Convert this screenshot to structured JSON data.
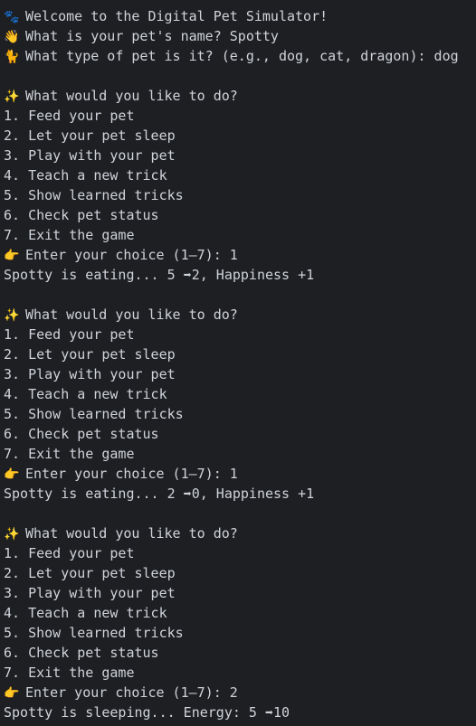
{
  "lines": [
    {
      "icon": "paw-icon",
      "glyph": "🐾",
      "text": "Welcome to the Digital Pet Simulator!"
    },
    {
      "icon": "waving-hand-icon",
      "glyph": "👋",
      "text": "What is your pet's name? Spotty"
    },
    {
      "icon": "cat-icon",
      "glyph": "🐈",
      "text": "What type of pet is it? (e.g., dog, cat, dragon): dog"
    },
    {
      "blank": true
    },
    {
      "icon": "sparkles-icon",
      "glyph": "✨",
      "text": "What would you like to do?"
    },
    {
      "text": "1. Feed your pet"
    },
    {
      "text": "2. Let your pet sleep"
    },
    {
      "text": "3. Play with your pet"
    },
    {
      "text": "4. Teach a new trick"
    },
    {
      "text": "5. Show learned tricks"
    },
    {
      "text": "6. Check pet status"
    },
    {
      "text": "7. Exit the game"
    },
    {
      "icon": "pointing-hand-icon",
      "glyph": "👉",
      "text": "Enter your choice (1–7): 1"
    },
    {
      "text": "Spotty is eating... 5 ➡2, Happiness +1"
    },
    {
      "blank": true
    },
    {
      "icon": "sparkles-icon",
      "glyph": "✨",
      "text": "What would you like to do?"
    },
    {
      "text": "1. Feed your pet"
    },
    {
      "text": "2. Let your pet sleep"
    },
    {
      "text": "3. Play with your pet"
    },
    {
      "text": "4. Teach a new trick"
    },
    {
      "text": "5. Show learned tricks"
    },
    {
      "text": "6. Check pet status"
    },
    {
      "text": "7. Exit the game"
    },
    {
      "icon": "pointing-hand-icon",
      "glyph": "👉",
      "text": "Enter your choice (1–7): 1"
    },
    {
      "text": "Spotty is eating... 2 ➡0, Happiness +1"
    },
    {
      "blank": true
    },
    {
      "icon": "sparkles-icon",
      "glyph": "✨",
      "text": "What would you like to do?"
    },
    {
      "text": "1. Feed your pet"
    },
    {
      "text": "2. Let your pet sleep"
    },
    {
      "text": "3. Play with your pet"
    },
    {
      "text": "4. Teach a new trick"
    },
    {
      "text": "5. Show learned tricks"
    },
    {
      "text": "6. Check pet status"
    },
    {
      "text": "7. Exit the game"
    },
    {
      "icon": "pointing-hand-icon",
      "glyph": "👉",
      "text": "Enter your choice (1–7): 2"
    },
    {
      "text": "Spotty is sleeping... Energy: 5 ➡10"
    }
  ],
  "colors": {
    "background": "#1e1f22",
    "text": "#cfd3da"
  }
}
